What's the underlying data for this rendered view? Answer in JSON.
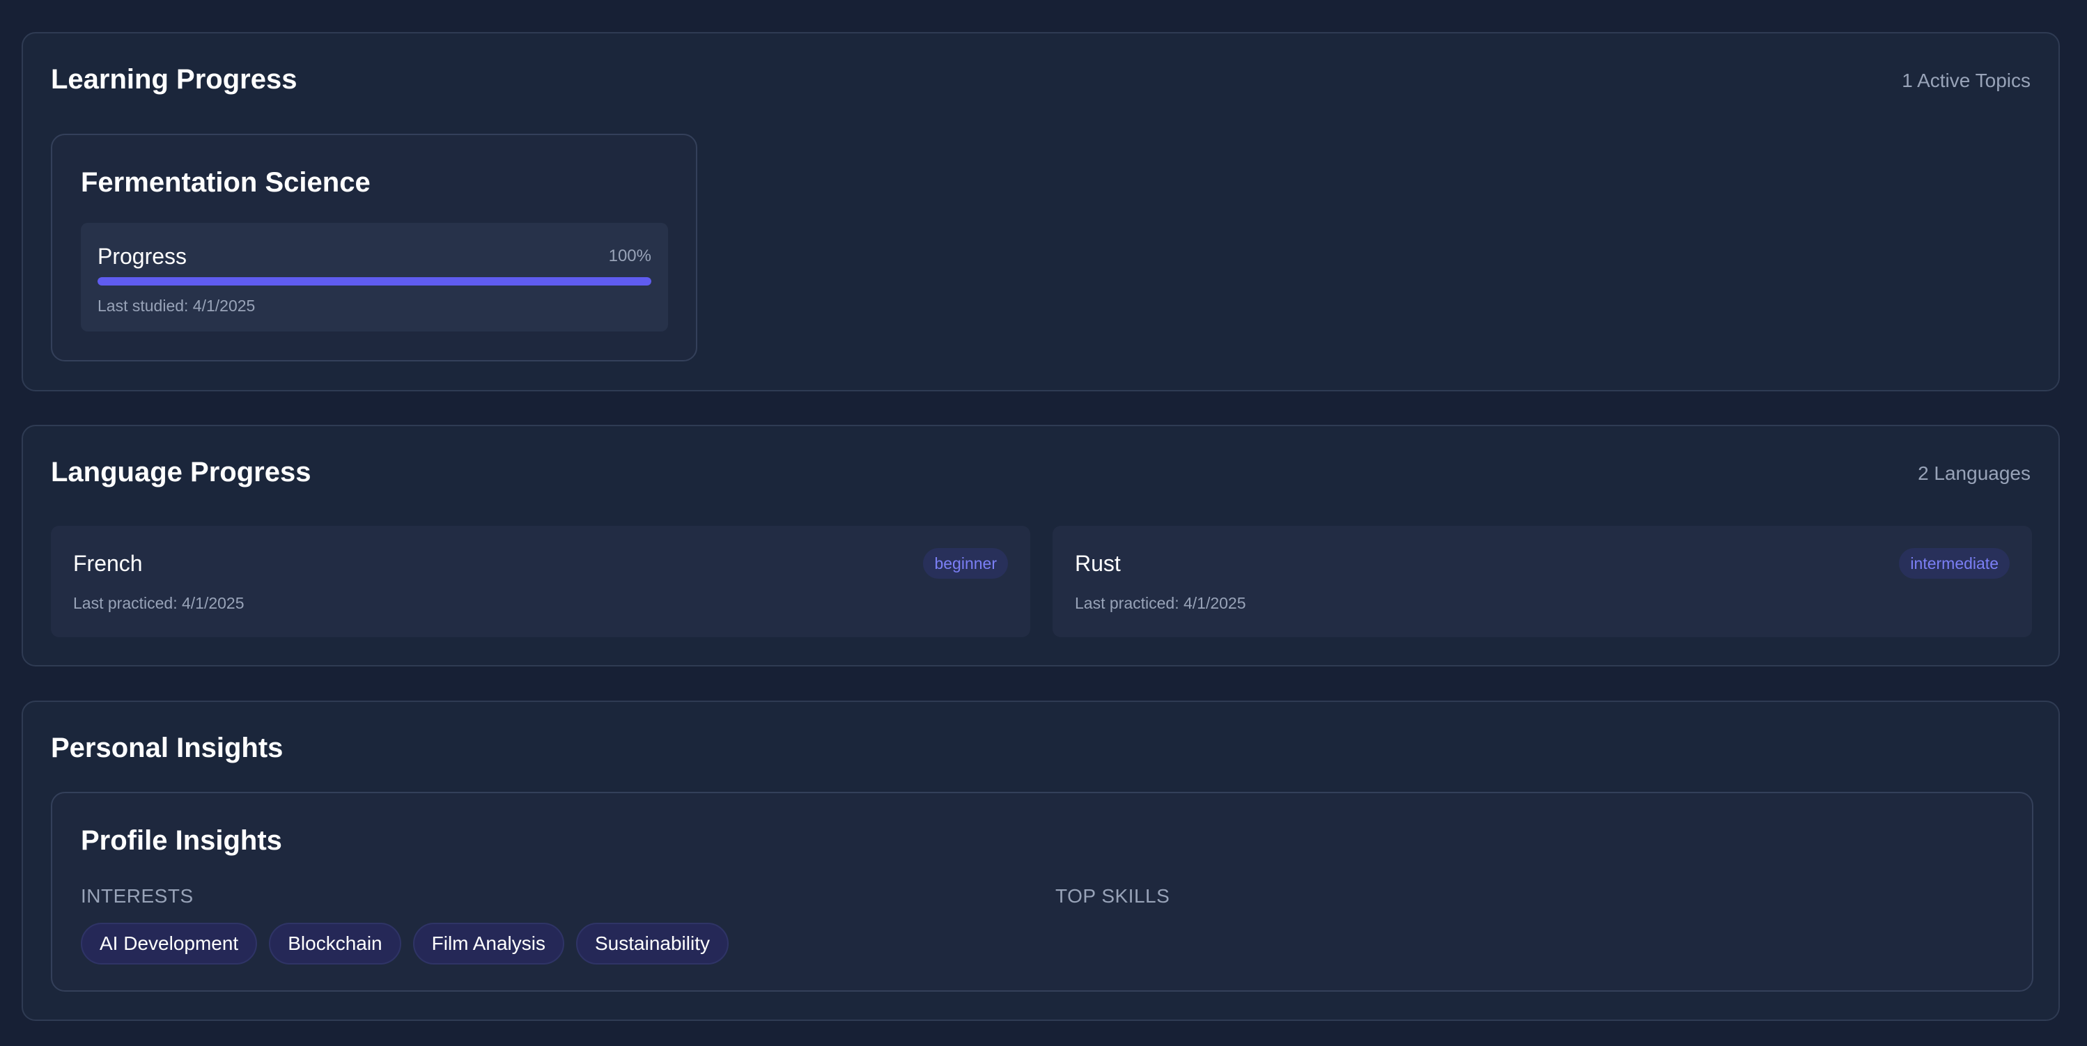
{
  "learning": {
    "title": "Learning Progress",
    "meta": "1 Active Topics",
    "topics": [
      {
        "title": "Fermentation Science",
        "progress_label": "Progress",
        "progress_text": "100%",
        "progress_fraction": 1.0,
        "last_studied": "Last studied: 4/1/2025"
      }
    ]
  },
  "language": {
    "title": "Language Progress",
    "meta": "2 Languages",
    "items": [
      {
        "name": "French",
        "level": "beginner",
        "last_practiced": "Last practiced: 4/1/2025"
      },
      {
        "name": "Rust",
        "level": "intermediate",
        "last_practiced": "Last practiced: 4/1/2025"
      }
    ]
  },
  "insights": {
    "title": "Personal Insights",
    "card_title": "Profile Insights",
    "interests_heading": "Interests",
    "skills_heading": "Top Skills",
    "interests": [
      "AI Development",
      "Blockchain",
      "Film Analysis",
      "Sustainability"
    ]
  },
  "colors": {
    "background": "#172035",
    "panel": "#1b263b",
    "accent": "#5f5cf0",
    "badge_text": "#7b7ff5",
    "muted_text": "#98a3b8"
  }
}
